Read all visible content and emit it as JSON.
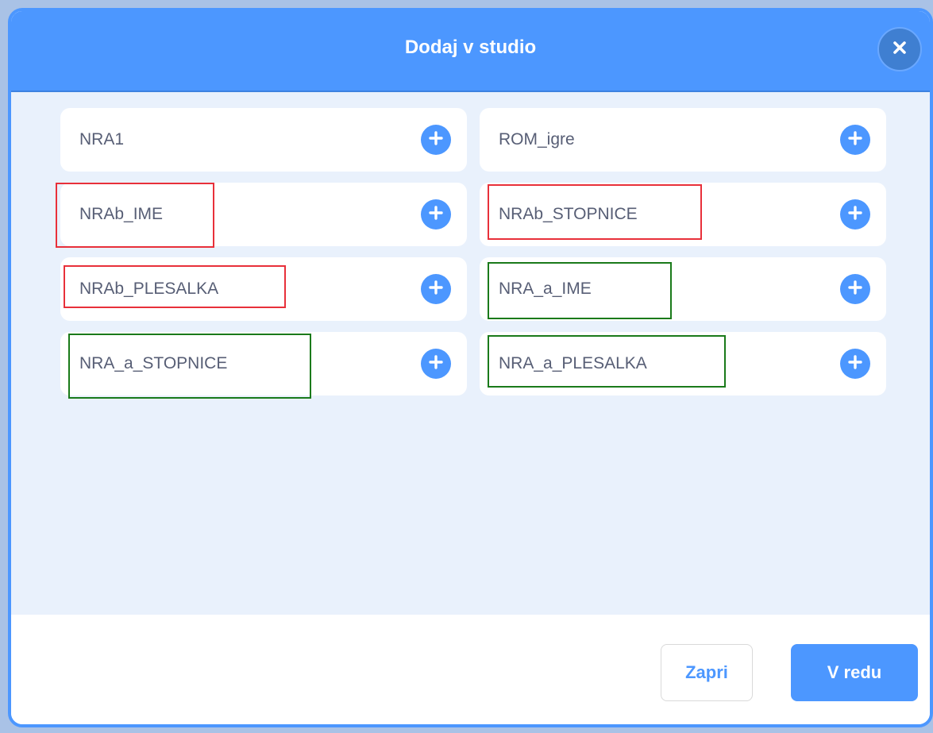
{
  "dialog": {
    "title": "Dodaj v studio"
  },
  "studios": [
    {
      "label": "NRA1",
      "highlight": ""
    },
    {
      "label": "ROM_igre",
      "highlight": ""
    },
    {
      "label": "NRAb_IME",
      "highlight": "red"
    },
    {
      "label": "NRAb_STOPNICE",
      "highlight": "red"
    },
    {
      "label": "NRAb_PLESALKA",
      "highlight": "red"
    },
    {
      "label": "NRA_a_IME",
      "highlight": "green"
    },
    {
      "label": "NRA_a_STOPNICE",
      "highlight": "green"
    },
    {
      "label": "NRA_a_PLESALKA",
      "highlight": "green"
    }
  ],
  "footer": {
    "close_label": "Zapri",
    "ok_label": "V redu"
  },
  "icons": {
    "close": "close-icon",
    "add": "plus-circle-icon"
  },
  "colors": {
    "accent": "#4c97ff",
    "highlight_red": "#e8303a",
    "highlight_green": "#1a7a1a"
  }
}
